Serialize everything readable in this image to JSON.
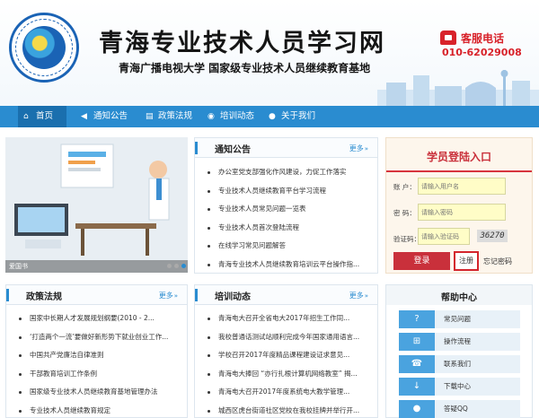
{
  "header": {
    "logo_text": "青海广播电视大学 Qinghai Radio & Television University",
    "site_title": "青海专业技术人员学习网",
    "site_subtitle": "青海广播电视大学   国家级专业技术人员继续教育基地",
    "hotline_label": "客服电话",
    "hotline_number": "010-62029008"
  },
  "nav": {
    "items": [
      {
        "label": "首页",
        "icon": "home-icon",
        "active": true
      },
      {
        "label": "通知公告",
        "icon": "megaphone-icon",
        "active": false
      },
      {
        "label": "政策法规",
        "icon": "book-icon",
        "active": false
      },
      {
        "label": "培训动态",
        "icon": "chat-icon",
        "active": false
      },
      {
        "label": "关于我们",
        "icon": "users-icon",
        "active": false
      }
    ]
  },
  "banner": {
    "caption": "爱国书",
    "slide_count": 3,
    "active_slide": 3
  },
  "notices": {
    "title": "通知公告",
    "more": "更多",
    "items": [
      "办公室党支部强化作风建设，力促工作落实",
      "专业技术人员继续教育平台学习流程",
      "专业技术人员常见问题一览表",
      "专业技术人员首次登陆流程",
      "在线学习常见问题解答",
      "青海专业技术人员继续教育培训云平台操作指..."
    ]
  },
  "policies": {
    "title": "政策法规",
    "more": "更多",
    "items": [
      "国家中长期人才发展规划纲要(2010 - 2...",
      "‘打造两个一流’要做好新形势下就业创业工作...",
      "中国共产党廉洁自律准则",
      "干部教育培训工作条例",
      "国家级专业技术人员继续教育基地管理办法",
      "专业技术人员继续教育规定"
    ]
  },
  "training": {
    "title": "培训动态",
    "more": "更多",
    "items": [
      "青海电大召开全省电大2017年招生工作同...",
      "我校普通话测试站顺利完成今年国家通用语言...",
      "学校召开2017年度精品课程建设证求意见...",
      "青海电大捧回 “亦行扎根计算机网络教室” 揭...",
      "青海电大召开2017年度系统电大教学管理...",
      "城西区虎台街道社区党校在我校挂牌并举行开..."
    ]
  },
  "login": {
    "title": "学员登陆入口",
    "username_label": "账  户：",
    "username_placeholder": "请输入用户名",
    "password_label": "密  码：",
    "password_placeholder": "请输入密码",
    "captcha_label": "验证码：",
    "captcha_placeholder": "请输入验证码",
    "captcha_code": "36270",
    "login_button": "登录",
    "register_button": "注册",
    "forgot_link": "忘记密码"
  },
  "help": {
    "title": "帮助中心",
    "items": [
      {
        "label": "常见问题",
        "icon": "question-icon",
        "color": "#4aa3df"
      },
      {
        "label": "操作流程",
        "icon": "flowchart-icon",
        "color": "#4aa3df"
      },
      {
        "label": "联系我们",
        "icon": "phone-icon",
        "color": "#4aa3df"
      },
      {
        "label": "下载中心",
        "icon": "download-icon",
        "color": "#4aa3df"
      },
      {
        "label": "答疑QQ",
        "icon": "qq-icon",
        "color": "#4aa3df"
      }
    ]
  },
  "colors": {
    "nav_blue": "#2a8cd0",
    "nav_active": "#1a6fae",
    "login_red": "#c9303b",
    "register_border": "#d4252d",
    "hotline_red": "#d8222a"
  }
}
